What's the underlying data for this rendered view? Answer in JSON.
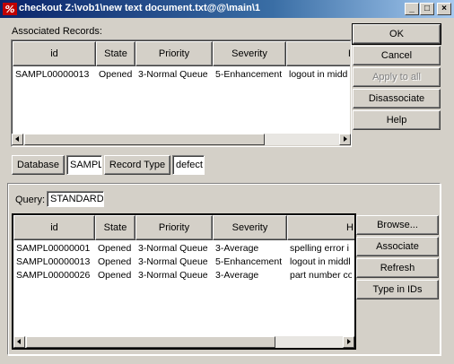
{
  "window": {
    "title": "checkout Z:\\vob1\\new text document.txt@@\\main\\1",
    "controls": {
      "minimize": "_",
      "maximize": "□",
      "close": "×"
    }
  },
  "associated": {
    "label": "Associated Records:",
    "columns": [
      "id",
      "State",
      "Priority",
      "Severity",
      "H"
    ],
    "rows": [
      [
        "SAMPL00000013",
        "Opened",
        "3-Normal Queue",
        "5-Enhancement",
        "logout in midd"
      ]
    ]
  },
  "right_buttons": {
    "ok": "OK",
    "cancel": "Cancel",
    "apply_to_all": "Apply to all",
    "disassociate": "Disassociate",
    "help": "Help"
  },
  "filter_bar": {
    "database_label": "Database",
    "database_value": "SAMPL",
    "record_type_label": "Record Type",
    "record_type_value": "defect"
  },
  "query": {
    "label": "Query:",
    "value": "STANDARD",
    "columns": [
      "id",
      "State",
      "Priority",
      "Severity",
      "H"
    ],
    "rows": [
      [
        "SAMPL00000001",
        "Opened",
        "3-Normal Queue",
        "3-Average",
        "spelling error i"
      ],
      [
        "SAMPL00000013",
        "Opened",
        "3-Normal Queue",
        "5-Enhancement",
        "logout in middl"
      ],
      [
        "SAMPL00000026",
        "Opened",
        "3-Normal Queue",
        "3-Average",
        "part number co"
      ]
    ]
  },
  "query_buttons": {
    "browse": "Browse...",
    "associate": "Associate",
    "refresh": "Refresh",
    "type_in_ids": "Type in IDs"
  }
}
